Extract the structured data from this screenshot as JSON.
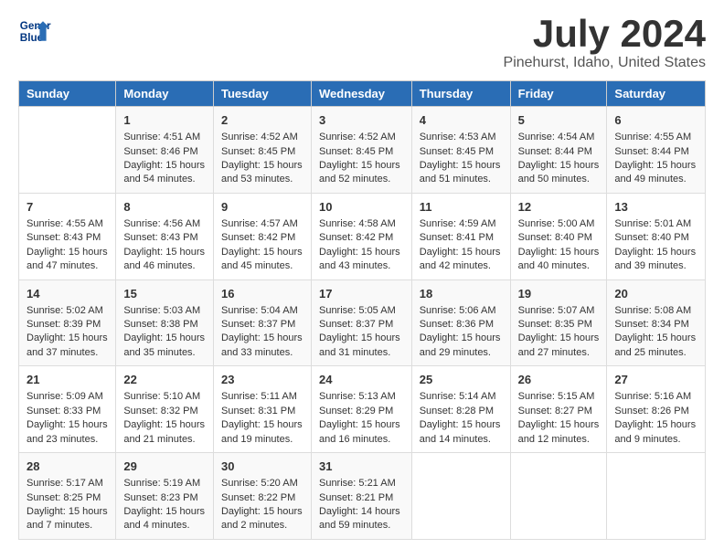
{
  "header": {
    "logo_line1": "General",
    "logo_line2": "Blue",
    "title": "July 2024",
    "subtitle": "Pinehurst, Idaho, United States"
  },
  "days_of_week": [
    "Sunday",
    "Monday",
    "Tuesday",
    "Wednesday",
    "Thursday",
    "Friday",
    "Saturday"
  ],
  "weeks": [
    [
      {
        "day": "",
        "content": ""
      },
      {
        "day": "1",
        "content": "Sunrise: 4:51 AM\nSunset: 8:46 PM\nDaylight: 15 hours\nand 54 minutes."
      },
      {
        "day": "2",
        "content": "Sunrise: 4:52 AM\nSunset: 8:45 PM\nDaylight: 15 hours\nand 53 minutes."
      },
      {
        "day": "3",
        "content": "Sunrise: 4:52 AM\nSunset: 8:45 PM\nDaylight: 15 hours\nand 52 minutes."
      },
      {
        "day": "4",
        "content": "Sunrise: 4:53 AM\nSunset: 8:45 PM\nDaylight: 15 hours\nand 51 minutes."
      },
      {
        "day": "5",
        "content": "Sunrise: 4:54 AM\nSunset: 8:44 PM\nDaylight: 15 hours\nand 50 minutes."
      },
      {
        "day": "6",
        "content": "Sunrise: 4:55 AM\nSunset: 8:44 PM\nDaylight: 15 hours\nand 49 minutes."
      }
    ],
    [
      {
        "day": "7",
        "content": "Sunrise: 4:55 AM\nSunset: 8:43 PM\nDaylight: 15 hours\nand 47 minutes."
      },
      {
        "day": "8",
        "content": "Sunrise: 4:56 AM\nSunset: 8:43 PM\nDaylight: 15 hours\nand 46 minutes."
      },
      {
        "day": "9",
        "content": "Sunrise: 4:57 AM\nSunset: 8:42 PM\nDaylight: 15 hours\nand 45 minutes."
      },
      {
        "day": "10",
        "content": "Sunrise: 4:58 AM\nSunset: 8:42 PM\nDaylight: 15 hours\nand 43 minutes."
      },
      {
        "day": "11",
        "content": "Sunrise: 4:59 AM\nSunset: 8:41 PM\nDaylight: 15 hours\nand 42 minutes."
      },
      {
        "day": "12",
        "content": "Sunrise: 5:00 AM\nSunset: 8:40 PM\nDaylight: 15 hours\nand 40 minutes."
      },
      {
        "day": "13",
        "content": "Sunrise: 5:01 AM\nSunset: 8:40 PM\nDaylight: 15 hours\nand 39 minutes."
      }
    ],
    [
      {
        "day": "14",
        "content": "Sunrise: 5:02 AM\nSunset: 8:39 PM\nDaylight: 15 hours\nand 37 minutes."
      },
      {
        "day": "15",
        "content": "Sunrise: 5:03 AM\nSunset: 8:38 PM\nDaylight: 15 hours\nand 35 minutes."
      },
      {
        "day": "16",
        "content": "Sunrise: 5:04 AM\nSunset: 8:37 PM\nDaylight: 15 hours\nand 33 minutes."
      },
      {
        "day": "17",
        "content": "Sunrise: 5:05 AM\nSunset: 8:37 PM\nDaylight: 15 hours\nand 31 minutes."
      },
      {
        "day": "18",
        "content": "Sunrise: 5:06 AM\nSunset: 8:36 PM\nDaylight: 15 hours\nand 29 minutes."
      },
      {
        "day": "19",
        "content": "Sunrise: 5:07 AM\nSunset: 8:35 PM\nDaylight: 15 hours\nand 27 minutes."
      },
      {
        "day": "20",
        "content": "Sunrise: 5:08 AM\nSunset: 8:34 PM\nDaylight: 15 hours\nand 25 minutes."
      }
    ],
    [
      {
        "day": "21",
        "content": "Sunrise: 5:09 AM\nSunset: 8:33 PM\nDaylight: 15 hours\nand 23 minutes."
      },
      {
        "day": "22",
        "content": "Sunrise: 5:10 AM\nSunset: 8:32 PM\nDaylight: 15 hours\nand 21 minutes."
      },
      {
        "day": "23",
        "content": "Sunrise: 5:11 AM\nSunset: 8:31 PM\nDaylight: 15 hours\nand 19 minutes."
      },
      {
        "day": "24",
        "content": "Sunrise: 5:13 AM\nSunset: 8:29 PM\nDaylight: 15 hours\nand 16 minutes."
      },
      {
        "day": "25",
        "content": "Sunrise: 5:14 AM\nSunset: 8:28 PM\nDaylight: 15 hours\nand 14 minutes."
      },
      {
        "day": "26",
        "content": "Sunrise: 5:15 AM\nSunset: 8:27 PM\nDaylight: 15 hours\nand 12 minutes."
      },
      {
        "day": "27",
        "content": "Sunrise: 5:16 AM\nSunset: 8:26 PM\nDaylight: 15 hours\nand 9 minutes."
      }
    ],
    [
      {
        "day": "28",
        "content": "Sunrise: 5:17 AM\nSunset: 8:25 PM\nDaylight: 15 hours\nand 7 minutes."
      },
      {
        "day": "29",
        "content": "Sunrise: 5:19 AM\nSunset: 8:23 PM\nDaylight: 15 hours\nand 4 minutes."
      },
      {
        "day": "30",
        "content": "Sunrise: 5:20 AM\nSunset: 8:22 PM\nDaylight: 15 hours\nand 2 minutes."
      },
      {
        "day": "31",
        "content": "Sunrise: 5:21 AM\nSunset: 8:21 PM\nDaylight: 14 hours\nand 59 minutes."
      },
      {
        "day": "",
        "content": ""
      },
      {
        "day": "",
        "content": ""
      },
      {
        "day": "",
        "content": ""
      }
    ]
  ]
}
